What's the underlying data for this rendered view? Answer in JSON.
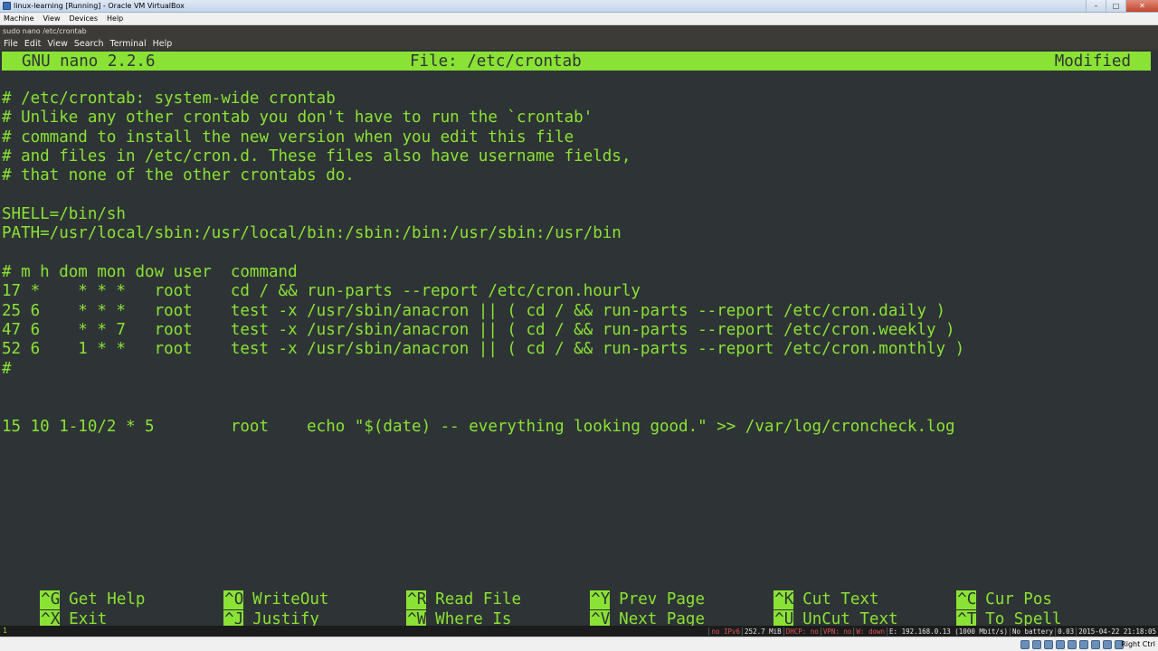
{
  "window": {
    "title": "linux-learning [Running] - Oracle VM VirtualBox",
    "minimize": "–",
    "maximize": "□",
    "close": "✕"
  },
  "host_menu": [
    "Machine",
    "View",
    "Devices",
    "Help"
  ],
  "terminal_title": "sudo nano /etc/crontab",
  "terminal_menu": [
    "File",
    "Edit",
    "View",
    "Search",
    "Terminal",
    "Help"
  ],
  "nano": {
    "version": "GNU nano 2.2.6",
    "file": "File: /etc/crontab",
    "state": "Modified"
  },
  "lines": [
    "# /etc/crontab: system-wide crontab",
    "# Unlike any other crontab you don't have to run the `crontab'",
    "# command to install the new version when you edit this file",
    "# and files in /etc/cron.d. These files also have username fields,",
    "# that none of the other crontabs do.",
    "",
    "SHELL=/bin/sh",
    "PATH=/usr/local/sbin:/usr/local/bin:/sbin:/bin:/usr/sbin:/usr/bin",
    "",
    "# m h dom mon dow user  command",
    "17 *    * * *   root    cd / && run-parts --report /etc/cron.hourly",
    "25 6    * * *   root    test -x /usr/sbin/anacron || ( cd / && run-parts --report /etc/cron.daily )",
    "47 6    * * 7   root    test -x /usr/sbin/anacron || ( cd / && run-parts --report /etc/cron.weekly )",
    "52 6    1 * *   root    test -x /usr/sbin/anacron || ( cd / && run-parts --report /etc/cron.monthly )",
    "#",
    "",
    "",
    "15 10 1-10/2 * 5        root    echo \"$(date) -- everything looking good.\" >> /var/log/croncheck.log"
  ],
  "shortcuts": [
    {
      "key": "^G",
      "label": "Get Help"
    },
    {
      "key": "^O",
      "label": "WriteOut"
    },
    {
      "key": "^R",
      "label": "Read File"
    },
    {
      "key": "^Y",
      "label": "Prev Page"
    },
    {
      "key": "^K",
      "label": "Cut Text"
    },
    {
      "key": "^C",
      "label": "Cur Pos"
    },
    {
      "key": "^X",
      "label": "Exit"
    },
    {
      "key": "^J",
      "label": "Justify"
    },
    {
      "key": "^W",
      "label": "Where Is"
    },
    {
      "key": "^V",
      "label": "Next Page"
    },
    {
      "key": "^U",
      "label": "UnCut Text"
    },
    {
      "key": "^T",
      "label": "To Spell"
    }
  ],
  "statusbar": {
    "left": "1",
    "ipv6": "no IPv6",
    "memory": "252.7 MiB",
    "dhcp": "DHCP: no",
    "vpn": "VPN: no",
    "wifi": "W: down",
    "ethernet": "E: 192.168.0.13 (1000 Mbit/s)",
    "battery": "No battery",
    "load": "0.03",
    "datetime": "2015-04-22 21:18:05"
  },
  "vbox_status": {
    "host_key": "Right Ctrl"
  },
  "colors": {
    "terminal_bg": "#2e3436",
    "terminal_fg": "#8ae234"
  }
}
